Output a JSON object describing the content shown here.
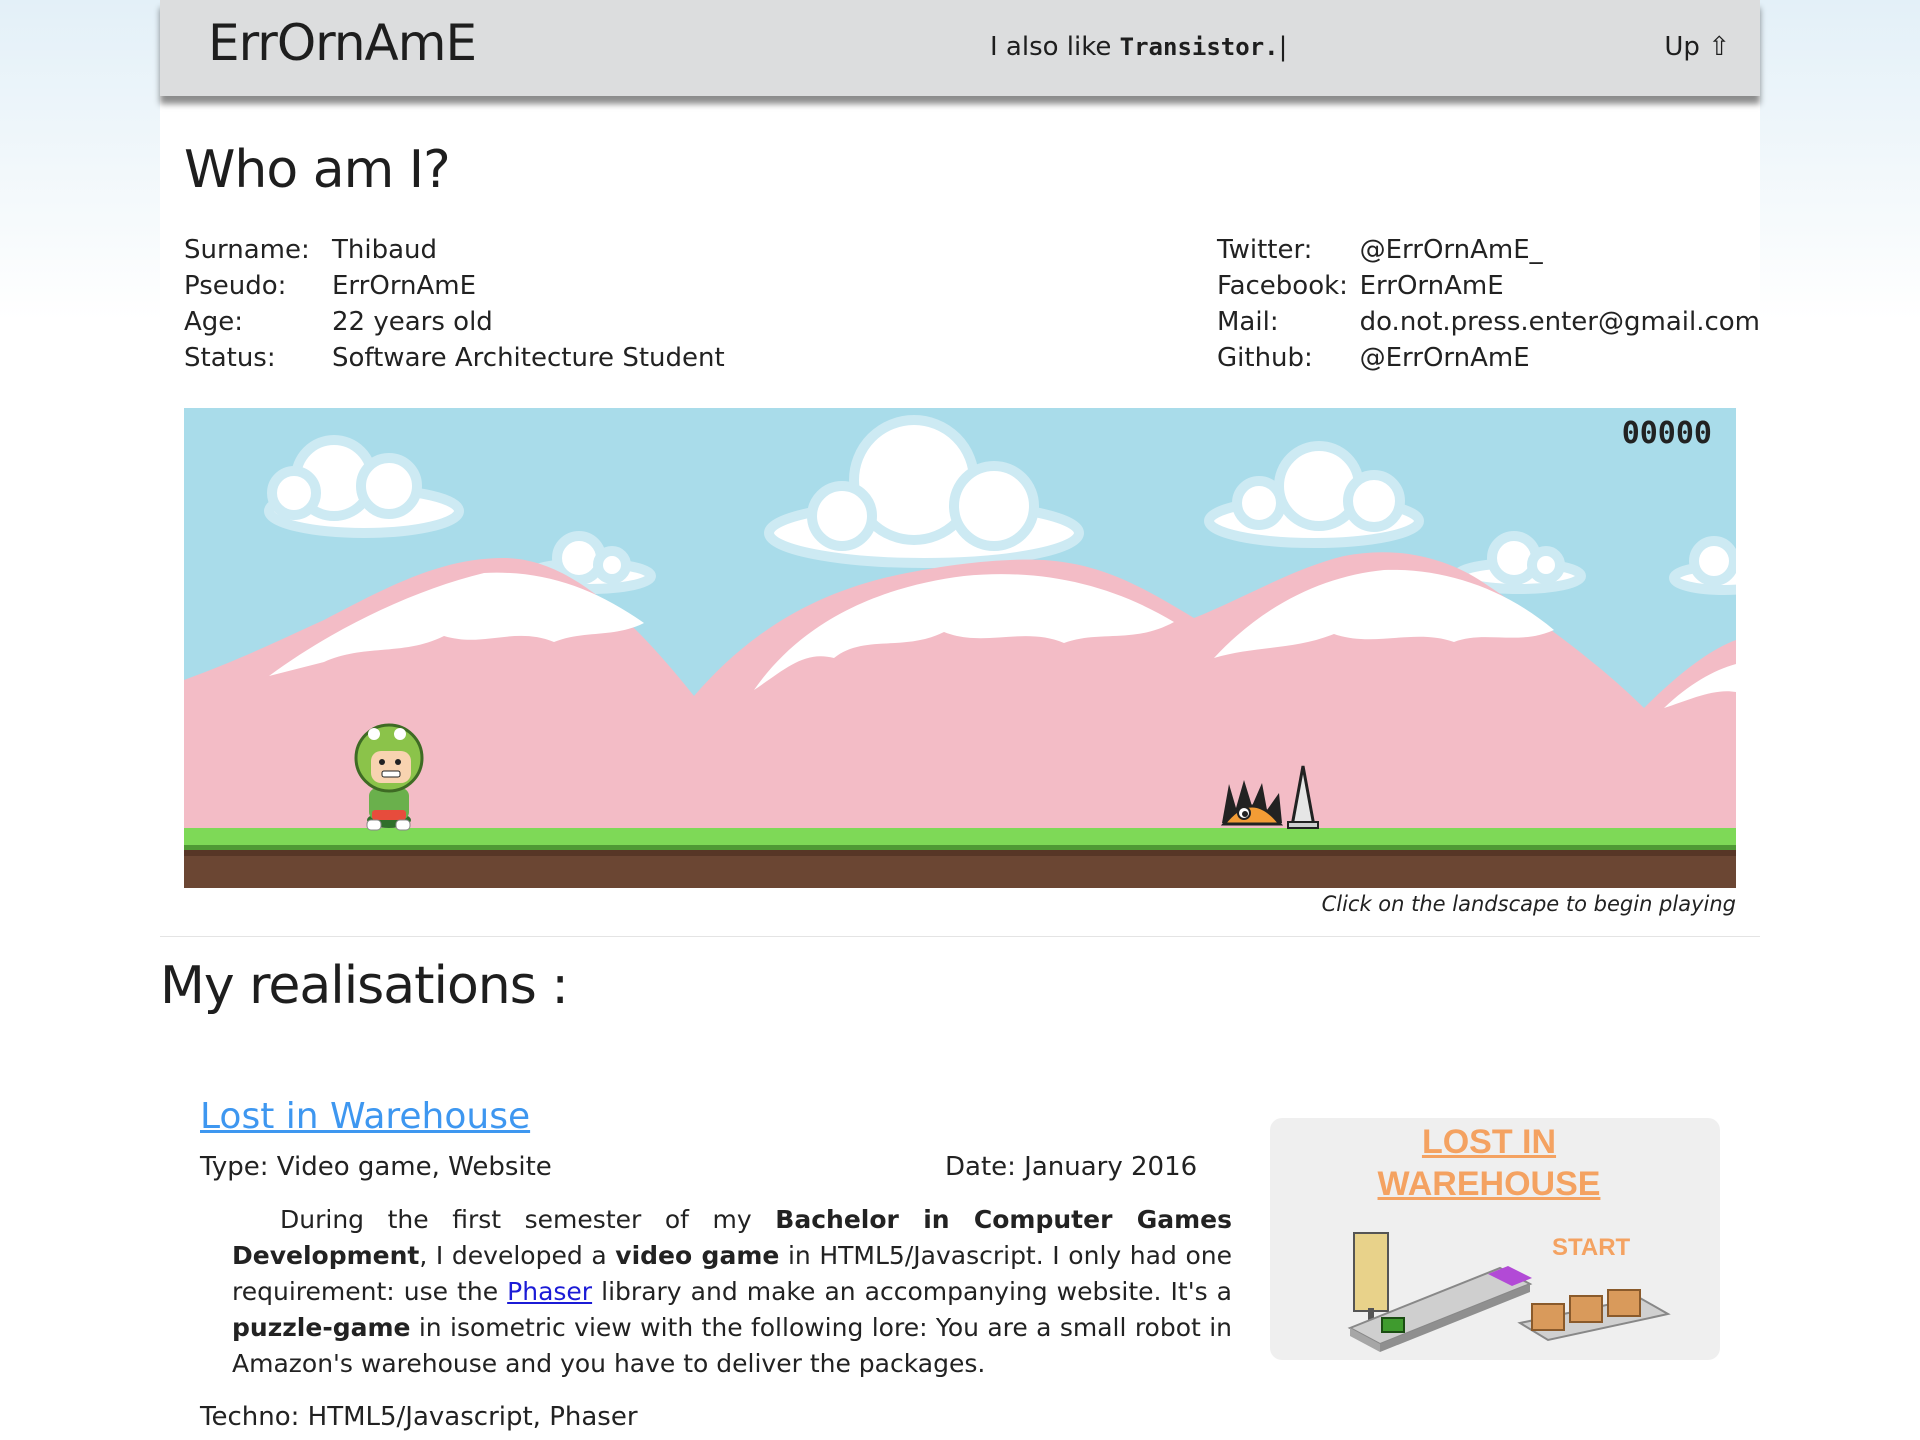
{
  "header": {
    "site_title": "ErrOrnAmE",
    "tagline_prefix": "I also like ",
    "tagline_word": "Transistor.",
    "tagline_cursor": "|",
    "up_label": "Up ⇧"
  },
  "about": {
    "title": "Who am I?",
    "left": [
      {
        "key": "Surname:",
        "value": "Thibaud"
      },
      {
        "key": "Pseudo:",
        "value": "ErrOrnAmE"
      },
      {
        "key": "Age:",
        "value": "22 years old"
      },
      {
        "key": "Status:",
        "value": "Software Architecture Student"
      }
    ],
    "right": [
      {
        "key": "Twitter:",
        "value": "@ErrOrnAmE_"
      },
      {
        "key": "Facebook:",
        "value": "ErrOrnAmE"
      },
      {
        "key": "Mail:",
        "value": "do.not.press.enter@gmail.com"
      },
      {
        "key": "Github:",
        "value": "@ErrOrnAmE"
      }
    ]
  },
  "game": {
    "score": "00000",
    "hint": "Click on the landscape to begin playing"
  },
  "realisations": {
    "title": "My realisations :",
    "project": {
      "title": "Lost in Warehouse",
      "type_label": "Type:",
      "type_value": " Video game, Website",
      "date_label": "Date:",
      "date_value": " January 2016",
      "desc": {
        "p1": "During the first semester of my ",
        "b1": "Bachelor in Computer Games Development",
        "p2": ", I developed a ",
        "b2": "video game",
        "p3": " in HTML5/Javascript. I only had one requirement: use the ",
        "link": "Phaser",
        "p4": " library and make an accompanying website. It's a ",
        "b3": "puzzle-game",
        "p5": " in isometric view with the following lore: You are a small robot in Amazon's warehouse and you have to deliver the packages."
      },
      "techno_label": "Techno:",
      "techno_value": " HTML5/Javascript, Phaser",
      "thumbnail": {
        "title_line1": "LOST IN",
        "title_line2": "WAREHOUSE",
        "start": "START"
      }
    }
  },
  "colors": {
    "header_bg": "#dcddde",
    "link": "#3e97f0",
    "sky": "#a9dcea",
    "mountain": "#f3bcc6",
    "grass": "#7ed957",
    "dirt": "#6b4633",
    "thumb_orange": "#f4a261"
  }
}
